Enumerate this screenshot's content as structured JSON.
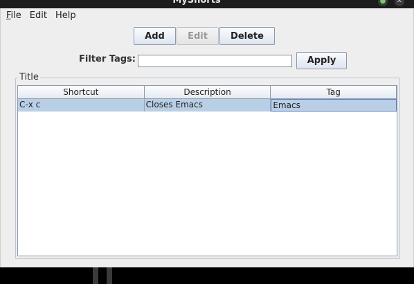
{
  "window": {
    "title": "MyShorts"
  },
  "titlebar_buttons": {
    "minimize": "●",
    "close": "✕"
  },
  "menubar": {
    "items": [
      {
        "label": "File",
        "mnemonic": "F",
        "rest": "ile"
      },
      {
        "label": "Edit"
      },
      {
        "label": "Help"
      }
    ]
  },
  "toolbar": {
    "add": "Add",
    "edit": "Edit",
    "delete": "Delete"
  },
  "filter": {
    "label": "Filter Tags:",
    "value": "",
    "apply": "Apply"
  },
  "group": {
    "title": "Title"
  },
  "table": {
    "columns": [
      "Shortcut",
      "Description",
      "Tag"
    ],
    "rows": [
      {
        "shortcut": "C-x c",
        "description": "Closes Emacs",
        "tag": "Emacs"
      }
    ],
    "selected_row": 0
  }
}
